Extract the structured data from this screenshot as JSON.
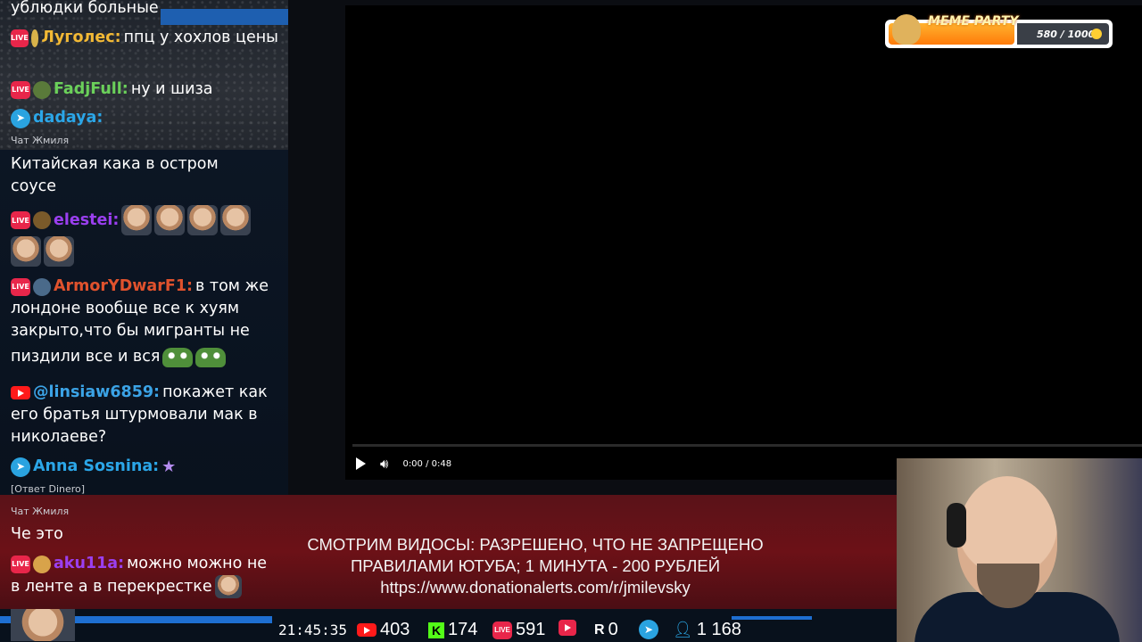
{
  "chat": {
    "messages": [
      {
        "user": "",
        "text": "ублюдки больные"
      },
      {
        "platform": "live",
        "user": "Луголес:",
        "text": "ппц у хохлов цены"
      },
      {
        "platform": "live",
        "user": "FadjFull:",
        "text": "ну и шиза"
      },
      {
        "platform": "telegram",
        "user": "dadaya:",
        "sub": "Чат Жмиля",
        "text": "Китайская кака в остром соусе"
      },
      {
        "platform": "live",
        "user": "elestei:"
      },
      {
        "platform": "live",
        "user": "ArmorYDwarF1:",
        "text1": "в том же",
        "text2": "лондоне вообще все к хуям",
        "text3": "закрыто,что бы мигранты не",
        "text4": "пиздили все и вся"
      },
      {
        "platform": "youtube",
        "user": "@linsiaw6859:",
        "text1": "покажет как",
        "text2": "его братья штурмовали мак в",
        "text3": "николаеве?"
      },
      {
        "platform": "telegram",
        "user": "Anna Sosnina:",
        "reply": "[Ответ Dinero]",
        "sub": "Чат Жмиля",
        "text": "Че это"
      },
      {
        "platform": "live",
        "user": "aku11a:",
        "text1": "можно можно не",
        "text2": "в ленте а в перекрестке"
      }
    ],
    "live_badge": "LIVE"
  },
  "player": {
    "time": "0:00 / 0:48",
    "progress": 0
  },
  "meme_party": {
    "title": "MEME PARTY",
    "count": "580 / 1000",
    "progress": 0.58
  },
  "banner": {
    "line1": "СМОТРИМ ВИДОСЫ: РАЗРЕШЕНО, ЧТО НЕ ЗАПРЕЩЕНО",
    "line2": "ПРАВИЛАМИ ЮТУБА; 1 МИНУТА - 200 РУБЛЕЙ",
    "line3": "https://www.donationalerts.com/r/jmilevsky"
  },
  "stats": {
    "clock": "21:45:35",
    "youtube": "403",
    "kick_letter": "K",
    "kick": "174",
    "live": "591",
    "r_letter": "R",
    "r": "0",
    "viewers": "1 168"
  },
  "colors": {
    "accent_blue": "#1e6fd1",
    "live_red": "#e8264a",
    "banner_red": "#6c1117"
  }
}
